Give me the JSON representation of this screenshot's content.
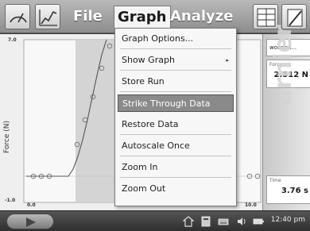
{
  "menubar": {
    "file": "File",
    "graph": "Graph",
    "analyze": "Analyze"
  },
  "graph": {
    "ylabel": "Force (N)",
    "y_top_tick": "7.0",
    "y_bottom_tick": "-1.0",
    "x_left_tick": "0.0",
    "x_right_tick": "10.0"
  },
  "panel": {
    "sensor": "wooden...",
    "force_label": "Force",
    "force_value": "2.512 N",
    "time_label": "Time",
    "time_value": "3.76 s",
    "watermark": "arnier"
  },
  "dropdown": {
    "items": [
      {
        "label": "Graph Options..."
      },
      {
        "label": "Show Graph"
      },
      {
        "label": "Store Run"
      },
      {
        "label": "Strike Through Data"
      },
      {
        "label": "Restore Data"
      },
      {
        "label": "Autoscale Once"
      },
      {
        "label": "Zoom In"
      },
      {
        "label": "Zoom Out"
      }
    ],
    "selected_index": 3
  },
  "taskbar": {
    "clock": "12:40 pm"
  },
  "icons": [
    "meter-icon",
    "graph-icon",
    "table-icon",
    "notebook-icon",
    "device-icon",
    "home-icon",
    "keyboard-icon",
    "volume-icon",
    "battery-icon"
  ]
}
